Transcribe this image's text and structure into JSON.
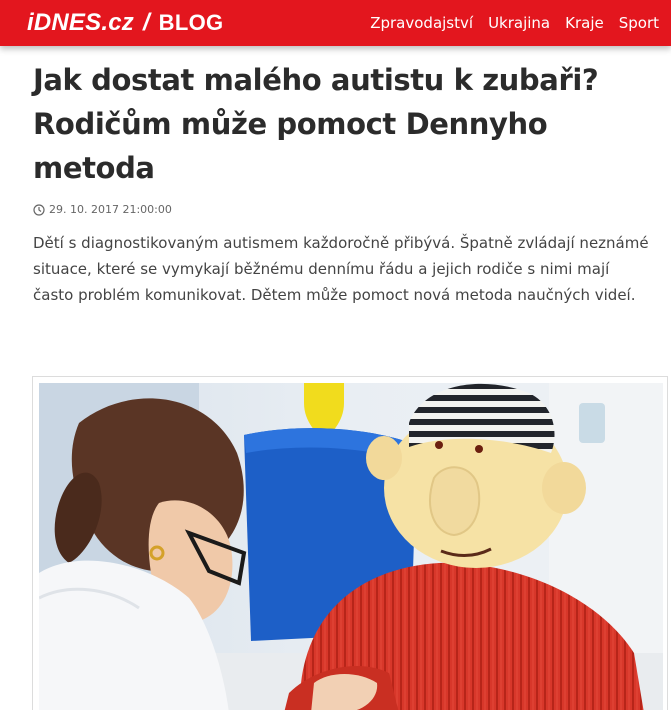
{
  "header": {
    "logo_brand": "iDNES.cz",
    "logo_separator": "/",
    "logo_section": "BLOG",
    "nav": [
      {
        "label": "Zpravodajství"
      },
      {
        "label": "Ukrajina"
      },
      {
        "label": "Kraje"
      },
      {
        "label": "Sport"
      }
    ],
    "accent_color": "#e3161e"
  },
  "article": {
    "title": "Jak dostat malého autistu k zubaři? Rodičům může pomoct Dennyho metoda",
    "datetime": "29. 10. 2017 21:00:00",
    "perex": "Dětí s diagnostikovaným autismem každoročně přibývá. Špatně zvládají neznámé situace, které se vymykají běžnému dennímu řádu a jejich rodiče s nimi mají často problém komunikovat. Dětem může pomoct nová metoda naučných videí."
  },
  "icons": {
    "clock": "clock-icon"
  }
}
